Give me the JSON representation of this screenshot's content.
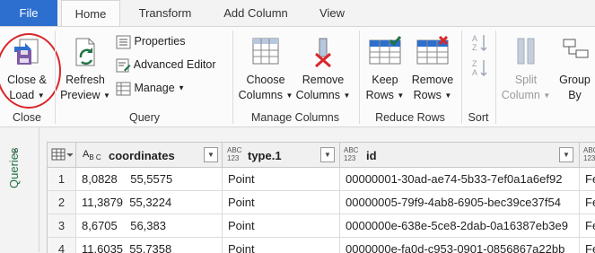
{
  "tabs": {
    "file": "File",
    "home": "Home",
    "transform": "Transform",
    "add_column": "Add Column",
    "view": "View"
  },
  "ribbon": {
    "close_load": [
      "Close &",
      "Load"
    ],
    "close_group": "Close",
    "refresh_preview": [
      "Refresh",
      "Preview"
    ],
    "properties": "Properties",
    "advanced_editor": "Advanced Editor",
    "manage": "Manage",
    "query_group": "Query",
    "choose_columns": [
      "Choose",
      "Columns"
    ],
    "remove_columns": [
      "Remove",
      "Columns"
    ],
    "manage_columns_group": "Manage Columns",
    "keep_rows": [
      "Keep",
      "Rows"
    ],
    "remove_rows": [
      "Remove",
      "Rows"
    ],
    "reduce_rows_group": "Reduce Rows",
    "sort_group": "Sort",
    "split_column": [
      "Split",
      "Column"
    ],
    "group_by": [
      "Group",
      "By"
    ]
  },
  "queries_pane": {
    "label": "Queries"
  },
  "grid": {
    "columns": [
      {
        "type_top": "A",
        "type_bottom": "B C",
        "name": "coordinates"
      },
      {
        "type_top": "ABC",
        "type_bottom": "123",
        "name": "type.1"
      },
      {
        "type_top": "ABC",
        "type_bottom": "123",
        "name": "id"
      },
      {
        "type_top": "ABC",
        "type_bottom": "123",
        "name": ""
      }
    ],
    "rows": [
      {
        "n": "1",
        "coordinates": "8,0828    55,5575",
        "type": "Point",
        "id": "00000001-30ad-ae74-5b33-7ef0a1a6ef92",
        "extra": "Fe"
      },
      {
        "n": "2",
        "coordinates": "11,3879  55,3224",
        "type": "Point",
        "id": "00000005-79f9-4ab8-6905-bec39ce37f54",
        "extra": "Fe"
      },
      {
        "n": "3",
        "coordinates": "8,6705    56,383",
        "type": "Point",
        "id": "0000000e-638e-5ce8-2dab-0a16387eb3e9",
        "extra": "Fe"
      },
      {
        "n": "4",
        "coordinates": "11,6035  55,7358",
        "type": "Point",
        "id": "0000000e-fa0d-c953-0901-0856867a22bb",
        "extra": "Fe"
      }
    ]
  },
  "colors": {
    "file_tab": "#2c6fce",
    "accent_green": "#217346",
    "annotation_circle": "#d9262b"
  }
}
